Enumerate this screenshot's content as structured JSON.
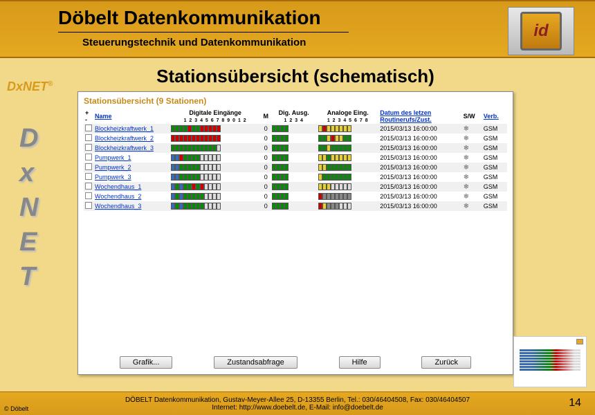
{
  "header": {
    "title": "Döbelt Datenkommunikation",
    "subtitle": "Steuerungstechnik und Datenkommunikation",
    "logo_text": "id"
  },
  "side": {
    "brand": "DxNET",
    "reg": "®",
    "letters": [
      "D",
      "x",
      "N",
      "E",
      "T"
    ]
  },
  "card": {
    "title": "Stationsübersicht (schematisch)",
    "panel_title": "Stationsübersicht (9 Stationen)"
  },
  "headers": {
    "plusminus": "+\n-",
    "name": "Name",
    "digin": "Digitale Eingänge",
    "digin_nums": "1 2 3 4 5 6 7 8 9 0 1 2",
    "m": "M",
    "digaus": "Dig. Ausg.",
    "digaus_nums": "1 2 3 4",
    "anaein": "Analoge Eing.",
    "anaein_nums": "1 2 3 4 5 6 7 8",
    "datum": "Datum des letzen\nRoutinerufs/Zust.",
    "sw": "S/W",
    "verb": "Verb."
  },
  "rows": [
    {
      "name": "Blockheizkraftwerk_1",
      "digin": [
        "g",
        "g",
        "g",
        "g",
        "r",
        "g",
        "g",
        "r",
        "r",
        "r",
        "r",
        "r"
      ],
      "m": "0",
      "da": [
        "g",
        "g",
        "g",
        "g"
      ],
      "ae": [
        "y",
        "r",
        "y",
        "y",
        "y",
        "y",
        "y",
        "y"
      ],
      "datum": "2015/03/13 16:00:00",
      "verb": "GSM"
    },
    {
      "name": "Blockheizkraftwerk_2",
      "digin": [
        "r",
        "r",
        "r",
        "r",
        "r",
        "r",
        "r",
        "r",
        "r",
        "r",
        "r",
        "r"
      ],
      "m": "0",
      "da": [
        "g",
        "g",
        "g",
        "g"
      ],
      "ae": [
        "g",
        "g",
        "y",
        "r",
        "y",
        "y",
        "g",
        "g"
      ],
      "datum": "2015/03/13 16:00:00",
      "verb": "GSM"
    },
    {
      "name": "Blockheizkraftwerk_3",
      "digin": [
        "g",
        "g",
        "g",
        "g",
        "g",
        "g",
        "g",
        "g",
        "g",
        "g",
        "g",
        "e"
      ],
      "m": "0",
      "da": [
        "g",
        "g",
        "g",
        "g"
      ],
      "ae": [
        "g",
        "g",
        "y",
        "g",
        "g",
        "g",
        "g",
        "g"
      ],
      "datum": "2015/03/13 16:00:00",
      "verb": "GSM"
    },
    {
      "name": "Pumpwerk_1",
      "digin": [
        "b",
        "b",
        "r",
        "g",
        "g",
        "g",
        "g",
        "e",
        "e",
        "e",
        "e",
        "e"
      ],
      "m": "0",
      "da": [
        "g",
        "g",
        "g",
        "g"
      ],
      "ae": [
        "y",
        "y",
        "g",
        "y",
        "y",
        "y",
        "y",
        "y"
      ],
      "datum": "2015/03/13 16:00:00",
      "verb": "GSM"
    },
    {
      "name": "Pumpwerk_2",
      "digin": [
        "b",
        "b",
        "g",
        "g",
        "g",
        "g",
        "g",
        "e",
        "e",
        "e",
        "e",
        "e"
      ],
      "m": "0",
      "da": [
        "g",
        "g",
        "g",
        "g"
      ],
      "ae": [
        "y",
        "y",
        "g",
        "g",
        "g",
        "g",
        "g",
        "g"
      ],
      "datum": "2015/03/13 16:00:00",
      "verb": "GSM"
    },
    {
      "name": "Pumpwerk_3",
      "digin": [
        "b",
        "b",
        "g",
        "g",
        "g",
        "g",
        "g",
        "e",
        "e",
        "e",
        "e",
        "e"
      ],
      "m": "0",
      "da": [
        "g",
        "g",
        "g",
        "g"
      ],
      "ae": [
        "y",
        "g",
        "g",
        "g",
        "g",
        "g",
        "g",
        "g"
      ],
      "datum": "2015/03/13 16:00:00",
      "verb": "GSM"
    },
    {
      "name": "Wochendhaus_1",
      "digin": [
        "b",
        "g",
        "b",
        "g",
        "g",
        "r",
        "g",
        "r",
        "e",
        "e",
        "e",
        "e"
      ],
      "m": "0",
      "da": [
        "g",
        "g",
        "g",
        "g"
      ],
      "ae": [
        "y",
        "y",
        "y",
        "e",
        "e",
        "e",
        "e",
        "e"
      ],
      "datum": "2015/03/13 16:00:00",
      "verb": "GSM"
    },
    {
      "name": "Wochendhaus_2",
      "digin": [
        "b",
        "g",
        "b",
        "g",
        "g",
        "g",
        "g",
        "g",
        "e",
        "e",
        "e",
        "e"
      ],
      "m": "0",
      "da": [
        "g",
        "g",
        "g",
        "g"
      ],
      "ae": [
        "r",
        "gr",
        "gr",
        "gr",
        "gr",
        "gr",
        "gr",
        "gr"
      ],
      "datum": "2015/03/13 16:00:00",
      "verb": "GSM"
    },
    {
      "name": "Wochendhaus_3",
      "digin": [
        "b",
        "g",
        "b",
        "g",
        "g",
        "g",
        "g",
        "g",
        "e",
        "e",
        "e",
        "e"
      ],
      "m": "0",
      "da": [
        "g",
        "g",
        "g",
        "g"
      ],
      "ae": [
        "r",
        "y",
        "gr",
        "gr",
        "gr",
        "e",
        "e",
        "e"
      ],
      "datum": "2015/03/13 16:00:00",
      "verb": "GSM"
    }
  ],
  "buttons": {
    "grafik": "Grafik...",
    "zustand": "Zustandsabfrage",
    "hilfe": "Hilfe",
    "zurueck": "Zurück"
  },
  "footer": {
    "line1": "DÖBELT Datenkommunikation, Gustav-Meyer-Allee 25, D-13355 Berlin, Tel.: 030/46404508, Fax: 030/46404507",
    "line2": "Internet: http://www.doebelt.de, E-Mail: info@doebelt.de",
    "copyright": "© Döbelt",
    "page": "14"
  }
}
